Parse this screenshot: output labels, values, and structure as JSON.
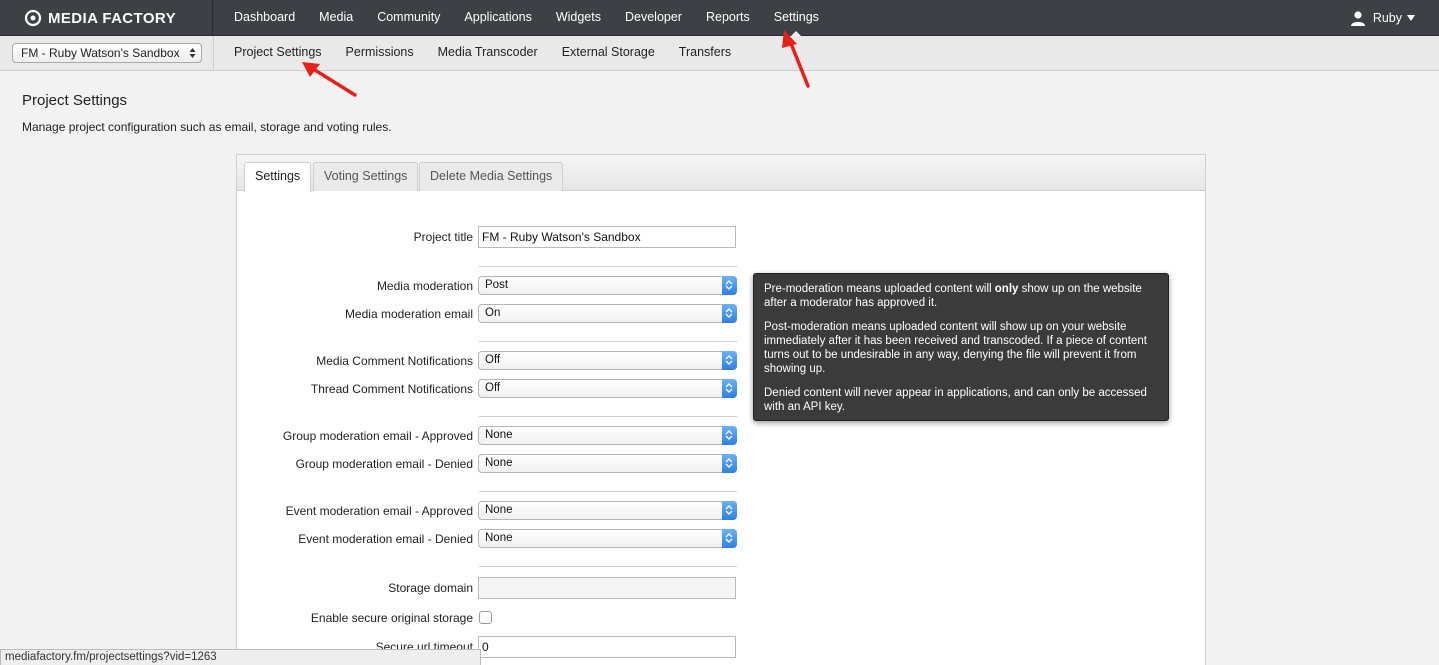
{
  "brand": {
    "name": "MEDIA FACTORY"
  },
  "nav": {
    "items": [
      "Dashboard",
      "Media",
      "Community",
      "Applications",
      "Widgets",
      "Developer",
      "Reports",
      "Settings"
    ],
    "active": "Settings"
  },
  "user": {
    "name": "Ruby"
  },
  "subnav": {
    "project_select": "FM - Ruby Watson's Sandbox",
    "items": [
      "Project Settings",
      "Permissions",
      "Media Transcoder",
      "External Storage",
      "Transfers"
    ]
  },
  "page": {
    "title": "Project Settings",
    "description": "Manage project configuration such as email, storage and voting rules."
  },
  "tabs": [
    "Settings",
    "Voting Settings",
    "Delete Media Settings"
  ],
  "form": {
    "project_title": {
      "label": "Project title",
      "value": "FM - Ruby Watson's Sandbox"
    },
    "media_moderation": {
      "label": "Media moderation",
      "value": "Post"
    },
    "media_moderation_email": {
      "label": "Media moderation email",
      "value": "On"
    },
    "media_comment_notifications": {
      "label": "Media Comment Notifications",
      "value": "Off"
    },
    "thread_comment_notifications": {
      "label": "Thread Comment Notifications",
      "value": "Off"
    },
    "group_mod_approved": {
      "label": "Group moderation email - Approved",
      "value": "None"
    },
    "group_mod_denied": {
      "label": "Group moderation email - Denied",
      "value": "None"
    },
    "event_mod_approved": {
      "label": "Event moderation email - Approved",
      "value": "None"
    },
    "event_mod_denied": {
      "label": "Event moderation email - Denied",
      "value": "None"
    },
    "storage_domain": {
      "label": "Storage domain",
      "value": ""
    },
    "secure_original_storage": {
      "label": "Enable secure original storage",
      "checked": false
    },
    "secure_url_timeout": {
      "label": "Secure url timeout",
      "value": "0"
    }
  },
  "tooltip": {
    "p1_before": "Pre-moderation means uploaded content will ",
    "p1_bold": "only",
    "p1_after": " show up on the website after a moderator has approved it.",
    "p2": "Post-moderation means uploaded content will show up on your website immediately after it has been received and transcoded. If a piece of content turns out to be undesirable in any way, denying the file will prevent it from showing up.",
    "p3": "Denied content will never appear in applications, and can only be accessed with an API key."
  },
  "status_bar": {
    "url": "mediafactory.fm/projectsettings?vid=1263"
  },
  "colors": {
    "topbar": "#3d4044",
    "select_arrow": "#2d7fe0",
    "annotation_arrow": "#e8201a"
  }
}
